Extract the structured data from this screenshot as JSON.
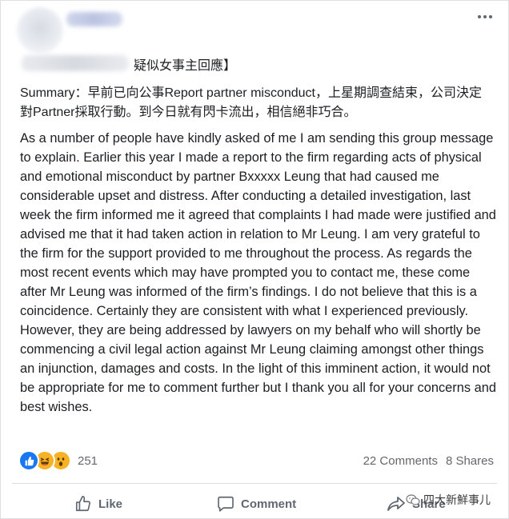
{
  "post": {
    "title_suffix": "疑似女事主回應】",
    "summary": "Summary：早前已向公事Report partner misconduct，上星期調查結束，公司決定對Partner採取行動。到今日就有閃卡流出，相信絕非巧合。",
    "body": "As a number of people have kindly asked of me I am sending this group message to explain. Earlier this year I made a report to the firm regarding acts of physical and emotional misconduct by partner Bxxxxx Leung that had caused me considerable upset and distress. After conducting a detailed investigation, last week the firm informed me it agreed that complaints I had made were justified and advised me that it had taken action in relation to Mr Leung. I am very grateful to the firm for the support provided to me throughout the process. As regards the most recent events which may have prompted you to contact me, these come after Mr Leung was informed of the firm’s findings. I do not believe that this is a coincidence. Certainly they are consistent with what I experienced previously. However, they are being addressed by lawyers on my behalf who will shortly be commencing a civil legal action against Mr Leung claiming amongst other things an injunction, damages and costs. In the light of this imminent action, it would not be appropriate for me to comment further but I thank you all for your concerns and best wishes."
  },
  "reactions": {
    "icons": [
      "like-icon",
      "haha-icon",
      "wow-icon"
    ],
    "count": "251"
  },
  "stats": {
    "comments": "22 Comments",
    "shares": "8 Shares"
  },
  "actions": {
    "like": "Like",
    "comment": "Comment",
    "share": "Share"
  },
  "watermark": {
    "text": "四大新鮮事儿"
  },
  "colors": {
    "like_blue": "#1877f2",
    "emoji_yellow": "#f7b125",
    "muted_text": "#65676b"
  }
}
